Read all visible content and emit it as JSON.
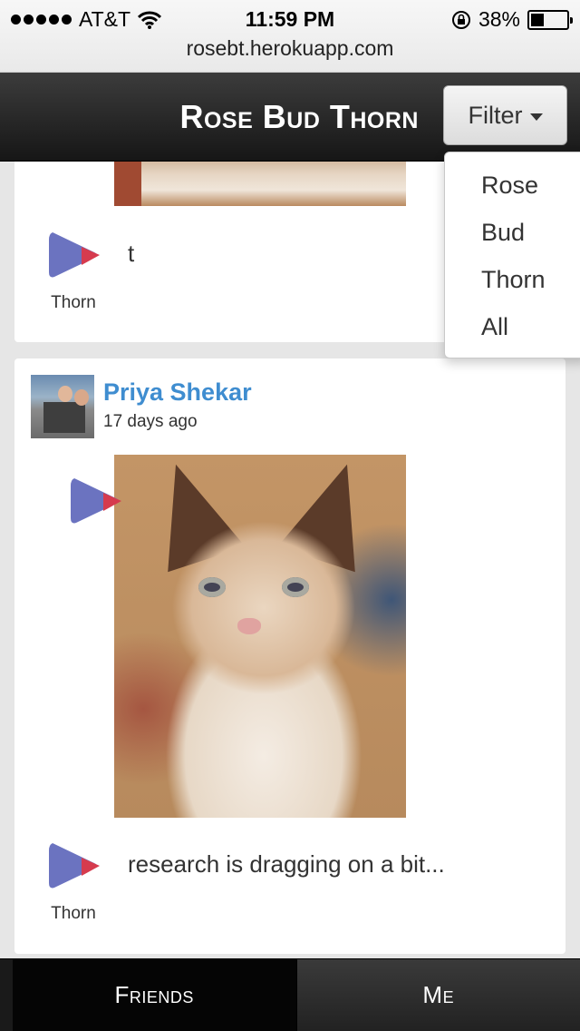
{
  "status_bar": {
    "carrier": "AT&T",
    "time": "11:59 PM",
    "battery": "38%",
    "battery_level": 0.38,
    "url": "rosebt.herokuapp.com"
  },
  "navbar": {
    "brand": "Rose Bud Thorn",
    "filter_label": "Filter"
  },
  "filter_menu": {
    "items": [
      "Rose",
      "Bud",
      "Thorn",
      "All"
    ]
  },
  "posts": [
    {
      "type_label": "Thorn",
      "text": "t"
    },
    {
      "user_name": "Priya Shekar",
      "time": "17 days ago",
      "type_label": "Thorn",
      "text": "research is dragging on a bit..."
    }
  ],
  "tabs": {
    "friends": "Friends",
    "me": "Me"
  },
  "colors": {
    "navbar_bg": "#1e1e1e",
    "link_blue": "#3f8dd0",
    "thorn_blue": "#6b73c0",
    "thorn_red": "#d63b4e"
  },
  "icons": {
    "thorn": "thorn-icon",
    "wifi": "wifi-icon",
    "lock": "rotation-lock-icon",
    "battery": "battery-icon"
  }
}
